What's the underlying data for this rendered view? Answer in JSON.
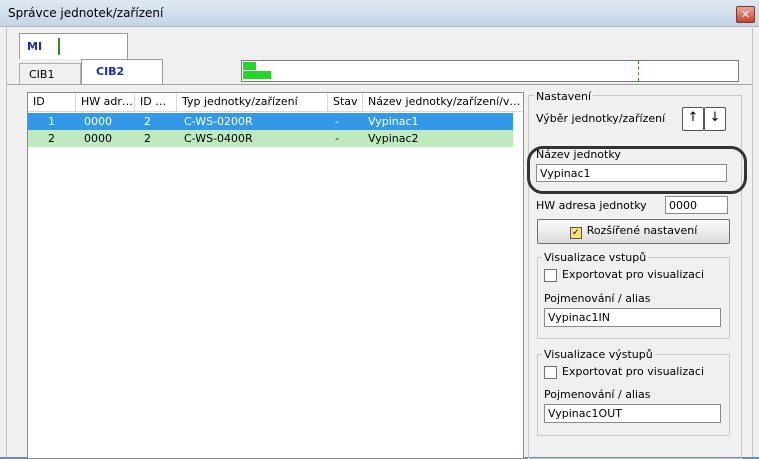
{
  "window": {
    "title": "Správce jednotek/zařízení",
    "close_glyph": "✕"
  },
  "tabs_top": [
    {
      "label": "MI"
    }
  ],
  "tabs_sub": [
    {
      "label": "CIB1"
    },
    {
      "label": "CIB2"
    }
  ],
  "list": {
    "columns": [
      "ID",
      "HW adr…",
      "ID …",
      "Typ jednotky/zařízení",
      "Stav",
      "Název jednotky/zařízení/v…"
    ],
    "rows": [
      {
        "id": "1",
        "hw": "0000",
        "id2": "2",
        "type": "C-WS-0200R",
        "state": "-",
        "name": "Vypinac1",
        "selected": true
      },
      {
        "id": "2",
        "hw": "0000",
        "id2": "2",
        "type": "C-WS-0400R",
        "state": "-",
        "name": "Vypinac2",
        "selected": false
      }
    ]
  },
  "settings": {
    "title": "Nastavení",
    "selection_label": "Výběr jednotky/zařízení",
    "up_arrow": "↑",
    "down_arrow": "↓",
    "unit_name_label": "Název jednotky",
    "unit_name_value": "Vypinac1",
    "hw_label": "HW adresa jednotky",
    "hw_value": "0000",
    "advanced_button": "Rozšířené nastavení",
    "advanced_icon": "✓"
  },
  "inputs_vis": {
    "title": "Visualizace vstupů",
    "export_label": "Exportovat pro visualizaci",
    "alias_label": "Pojmenování / alias",
    "alias_value": "Vypinac1IN"
  },
  "outputs_vis": {
    "title": "Visualizace výstupů",
    "export_label": "Exportovat pro visualizaci",
    "alias_label": "Pojmenování / alias",
    "alias_value": "Vypinac1OUT"
  },
  "colors": {
    "selected_row": "#3399e6",
    "other_row": "#bfeabf",
    "tab_text": "#1a2fa8",
    "progress_fill": "#26d626"
  }
}
